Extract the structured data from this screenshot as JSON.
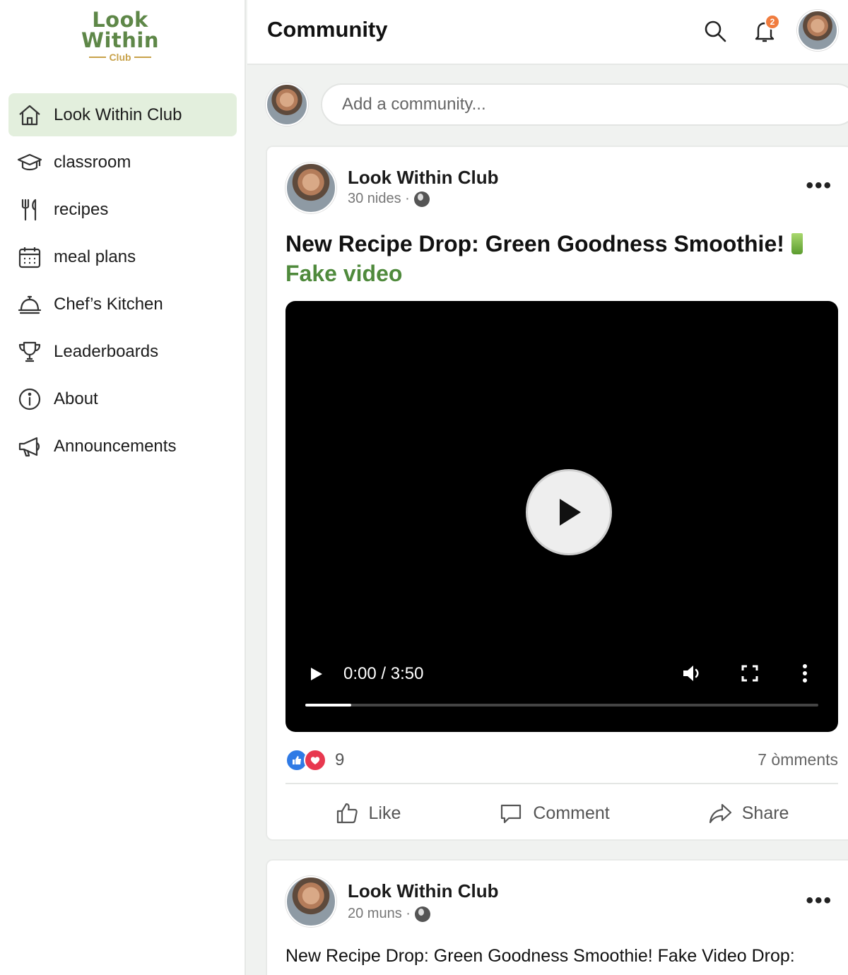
{
  "brand": {
    "line1": "Look",
    "line2": "Within",
    "line3": "Club"
  },
  "sidebar": {
    "items": [
      {
        "label": "Look Within Club",
        "icon": "home-icon",
        "active": true
      },
      {
        "label": "classroom",
        "icon": "graduation-cap-icon"
      },
      {
        "label": "recipes",
        "icon": "fork-knife-icon"
      },
      {
        "label": "meal plans",
        "icon": "calendar-icon"
      },
      {
        "label": "Chef’s Kitchen",
        "icon": "cloche-icon"
      },
      {
        "label": "Leaderboards",
        "icon": "trophy-icon"
      },
      {
        "label": "About",
        "icon": "info-icon"
      },
      {
        "label": "Announcements",
        "icon": "megaphone-icon"
      }
    ]
  },
  "header": {
    "title": "Community",
    "notification_badge": "2"
  },
  "composer": {
    "placeholder": "Add a community..."
  },
  "posts": [
    {
      "author": "Look Within Club",
      "meta": "30 nides ·",
      "title": "New Recipe Drop: Green Goodness Smoothie!",
      "subtitle": "Fake video",
      "video": {
        "time": "0:00 / 3:50",
        "progress": 0.09
      },
      "reaction_count": "9",
      "comments": "7 òmments",
      "actions": {
        "like": "Like",
        "comment": "Comment",
        "share": "Share"
      }
    },
    {
      "author": "Look Within Club",
      "meta": "20 muns ·",
      "text": "New Recipe Drop: Green Goodness Smoothie! Fake Video Drop:"
    }
  ],
  "colors": {
    "brand_green": "#5e8748",
    "accent_green": "#4f8a3c",
    "active_bg": "#e3efdd",
    "badge": "#f07c3e",
    "like": "#2f7ae5",
    "love": "#e8384f"
  }
}
